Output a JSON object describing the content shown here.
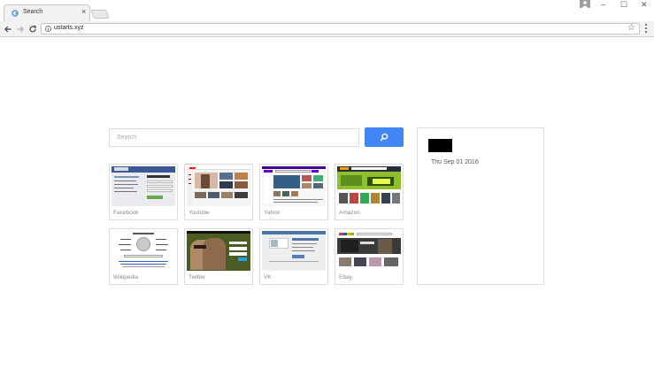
{
  "browser": {
    "tab_title": "Search",
    "tab_close": "×",
    "url": "ustarts.xyz",
    "star": "☆",
    "minimize": "–",
    "maximize": "☐",
    "close": "✕"
  },
  "search": {
    "placeholder": "Search"
  },
  "tiles": [
    {
      "label": "Facebook"
    },
    {
      "label": "Youtube"
    },
    {
      "label": "Yahoo"
    },
    {
      "label": "Amazon"
    },
    {
      "label": "Wikipedia"
    },
    {
      "label": "Twitter"
    },
    {
      "label": "VK"
    },
    {
      "label": "Ebay"
    }
  ],
  "panel": {
    "date": "Thu Sep 01 2016"
  },
  "colors": {
    "accent": "#4285f4",
    "border": "#dcdcdc"
  }
}
